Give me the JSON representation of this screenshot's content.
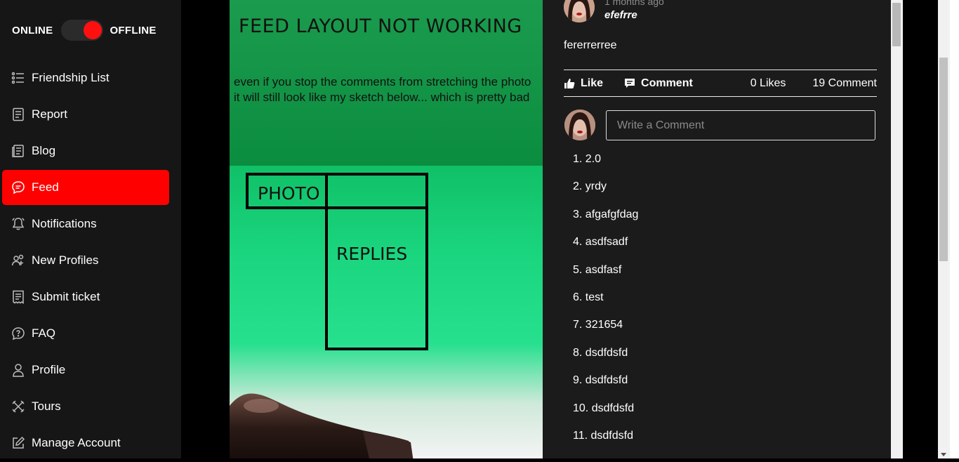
{
  "sidebar": {
    "status": {
      "online_label": "ONLINE",
      "offline_label": "OFFLINE"
    },
    "items": [
      {
        "label": "Friendship List",
        "icon": "list-icon"
      },
      {
        "label": "Report",
        "icon": "report-icon"
      },
      {
        "label": "Blog",
        "icon": "blog-icon"
      },
      {
        "label": "Feed",
        "icon": "chat-icon",
        "active": true
      },
      {
        "label": "Notifications",
        "icon": "bell-icon"
      },
      {
        "label": "New Profiles",
        "icon": "add-user-icon"
      },
      {
        "label": "Submit ticket",
        "icon": "ticket-icon"
      },
      {
        "label": "FAQ",
        "icon": "help-icon"
      },
      {
        "label": "Profile",
        "icon": "user-icon"
      },
      {
        "label": "Tours",
        "icon": "tours-icon"
      },
      {
        "label": "Manage Account",
        "icon": "edit-icon"
      }
    ]
  },
  "post": {
    "image": {
      "title": "FEED LAYOUT NOT WORKING",
      "text": "even if you stop the comments from stretching the photo it will still look like my sketch below... which is pretty bad",
      "sketch_photo_label": "PHOTO",
      "sketch_replies_label": "REPLIES"
    },
    "time": "1 months ago",
    "author": "efefrre",
    "body": "fererrerree",
    "actions": {
      "like_label": "Like",
      "comment_label": "Comment",
      "likes_count": "0 Likes",
      "comments_count": "19 Comment"
    },
    "comment_placeholder": "Write a Comment",
    "comments": [
      "1. 2.0",
      "2. yrdy",
      "3. afgafgfdag",
      "4. asdfsadf",
      "5. asdfasf",
      "6. test",
      "7. 321654",
      "8. dsdfdsfd",
      "9. dsdfdsfd",
      "10. dsdfdsfd",
      "11. dsdfdsfd"
    ]
  },
  "colors": {
    "accent": "#ff0000",
    "sidebar_bg": "#161616",
    "panel_bg": "#1b1b1b"
  }
}
